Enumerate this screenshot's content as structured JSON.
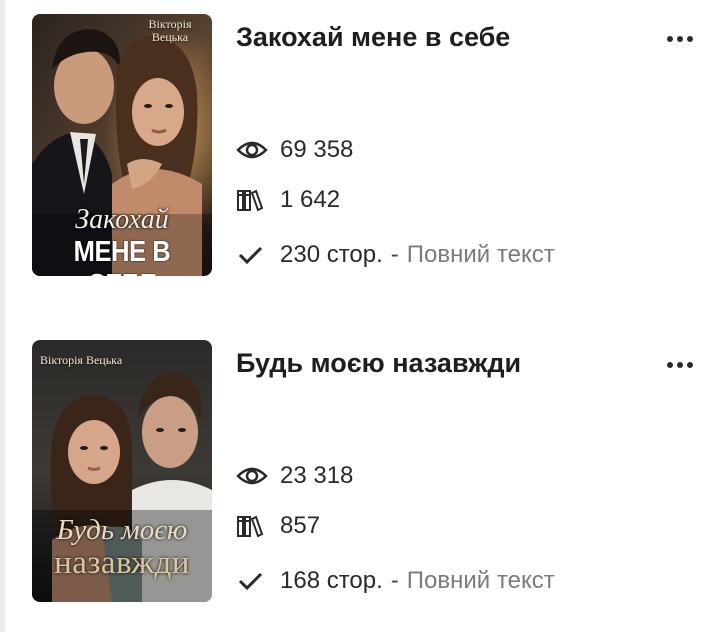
{
  "books": [
    {
      "cover_author": "Вікторія Вецька",
      "cover_title_line1": "Закохай",
      "cover_title_line2": "МЕНЕ В СЕБЕ",
      "title": "Закохай мене в себе",
      "views": "69 358",
      "libraries": "1 642",
      "pages": "230 стор.",
      "separator": "-",
      "status": "Повний текст"
    },
    {
      "cover_author": "Вікторія Вецька",
      "cover_title_line1": "Будь моєю",
      "cover_title_line2": "назавжди",
      "title": "Будь моєю назавжди",
      "views": "23 318",
      "libraries": "857",
      "pages": "168 стор.",
      "separator": "-",
      "status": "Повний текст"
    }
  ],
  "icons": {
    "views": "eye-icon",
    "libraries": "books-icon",
    "pages": "checkmark-icon",
    "menu": "more-dots-icon"
  },
  "colors": {
    "text": "#1e1e1e",
    "muted": "#7b7b7b",
    "background": "#ffffff"
  }
}
